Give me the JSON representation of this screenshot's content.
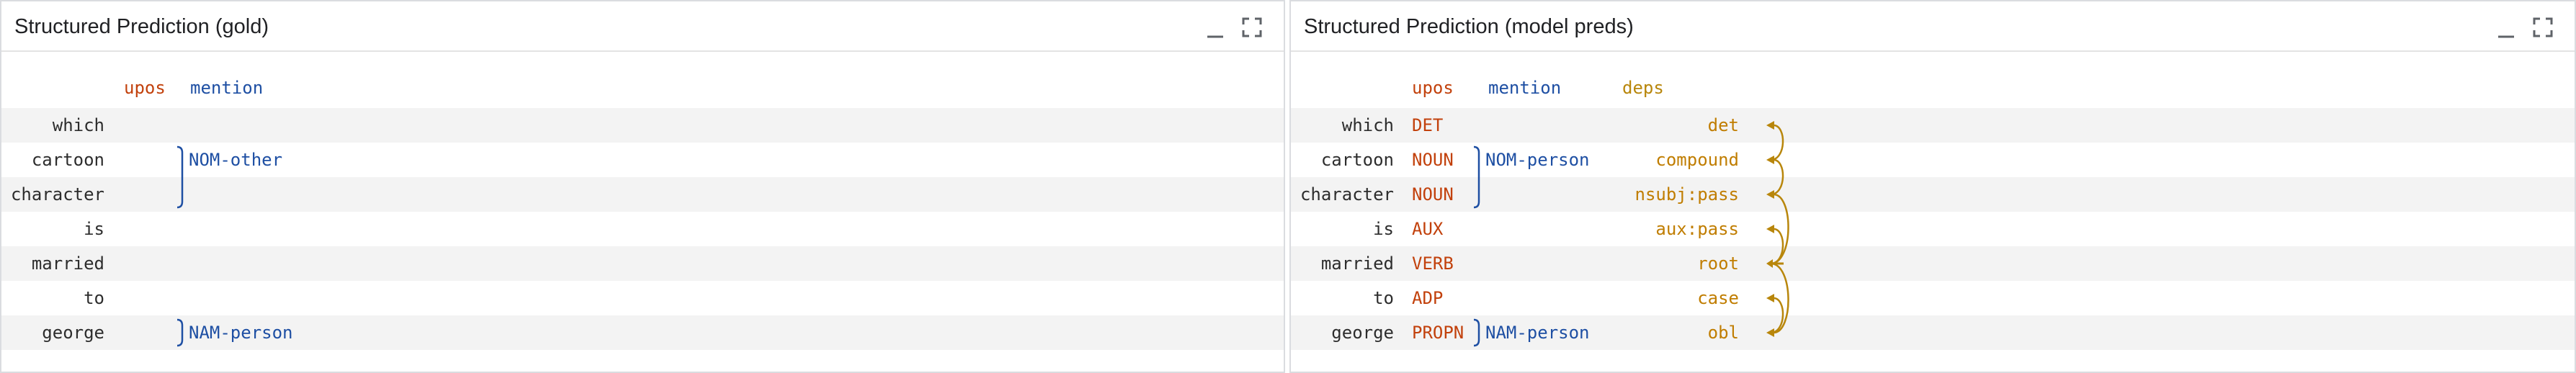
{
  "colors": {
    "upos": "#c2410c",
    "mention": "#1e4fa3",
    "deps": "#b8860b",
    "row_shade": "#f3f3f3"
  },
  "gold": {
    "title": "Structured Prediction (gold)",
    "headers": {
      "upos": "upos",
      "mention": "mention"
    },
    "tokens": [
      "which",
      "cartoon",
      "character",
      "is",
      "married",
      "to",
      "george"
    ],
    "mentions": [
      {
        "label": "NOM-other",
        "start": 1,
        "end": 2
      },
      {
        "label": "NAM-person",
        "start": 6,
        "end": 6
      }
    ]
  },
  "pred": {
    "title": "Structured Prediction (model preds)",
    "headers": {
      "upos": "upos",
      "mention": "mention",
      "deps": "deps"
    },
    "tokens": [
      "which",
      "cartoon",
      "character",
      "is",
      "married",
      "to",
      "george"
    ],
    "upos": [
      "DET",
      "NOUN",
      "NOUN",
      "AUX",
      "VERB",
      "ADP",
      "PROPN"
    ],
    "mentions": [
      {
        "label": "NOM-person",
        "start": 1,
        "end": 2
      },
      {
        "label": "NAM-person",
        "start": 6,
        "end": 6
      }
    ],
    "deps": [
      "det",
      "compound",
      "nsubj:pass",
      "aux:pass",
      "root",
      "case",
      "obl"
    ],
    "heads": [
      1,
      2,
      4,
      4,
      -1,
      6,
      4
    ]
  },
  "icons": {
    "minimize": "minimize-icon",
    "maximize": "fullscreen-icon"
  }
}
